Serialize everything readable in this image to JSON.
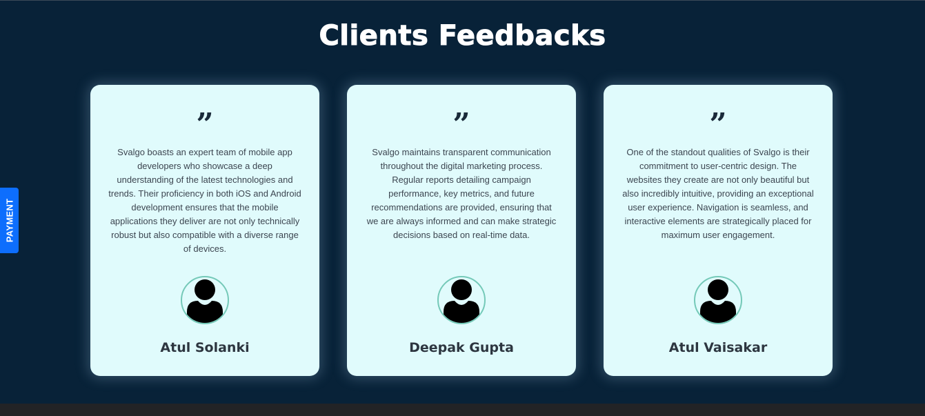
{
  "section": {
    "title": "Clients Feedbacks"
  },
  "payment_tab": {
    "label": "PAYMENT",
    "color": "#0d6efd"
  },
  "colors": {
    "background": "#082238",
    "card": "#e0fbfc",
    "avatar_ring": "#74c9b8"
  },
  "testimonials": [
    {
      "quote_icon": "quote-icon",
      "text": "Svalgo boasts an expert team of mobile app developers who showcase a deep understanding of the latest technologies and trends. Their proficiency in both iOS and Android development ensures that the mobile applications they deliver are not only technically robust but also compatible with a diverse range of devices.",
      "avatar_icon": "user-avatar-icon",
      "name": "Atul Solanki"
    },
    {
      "quote_icon": "quote-icon",
      "text": "Svalgo maintains transparent communication throughout the digital marketing process. Regular reports detailing campaign performance, key metrics, and future recommendations are provided, ensuring that we are always informed and can make strategic decisions based on real-time data.",
      "avatar_icon": "user-avatar-icon",
      "name": "Deepak Gupta"
    },
    {
      "quote_icon": "quote-icon",
      "text": "One of the standout qualities of Svalgo is their commitment to user-centric design. The websites they create are not only beautiful but also incredibly intuitive, providing an exceptional user experience. Navigation is seamless, and interactive elements are strategically placed for maximum user engagement.",
      "avatar_icon": "user-avatar-icon",
      "name": "Atul Vaisakar"
    }
  ]
}
